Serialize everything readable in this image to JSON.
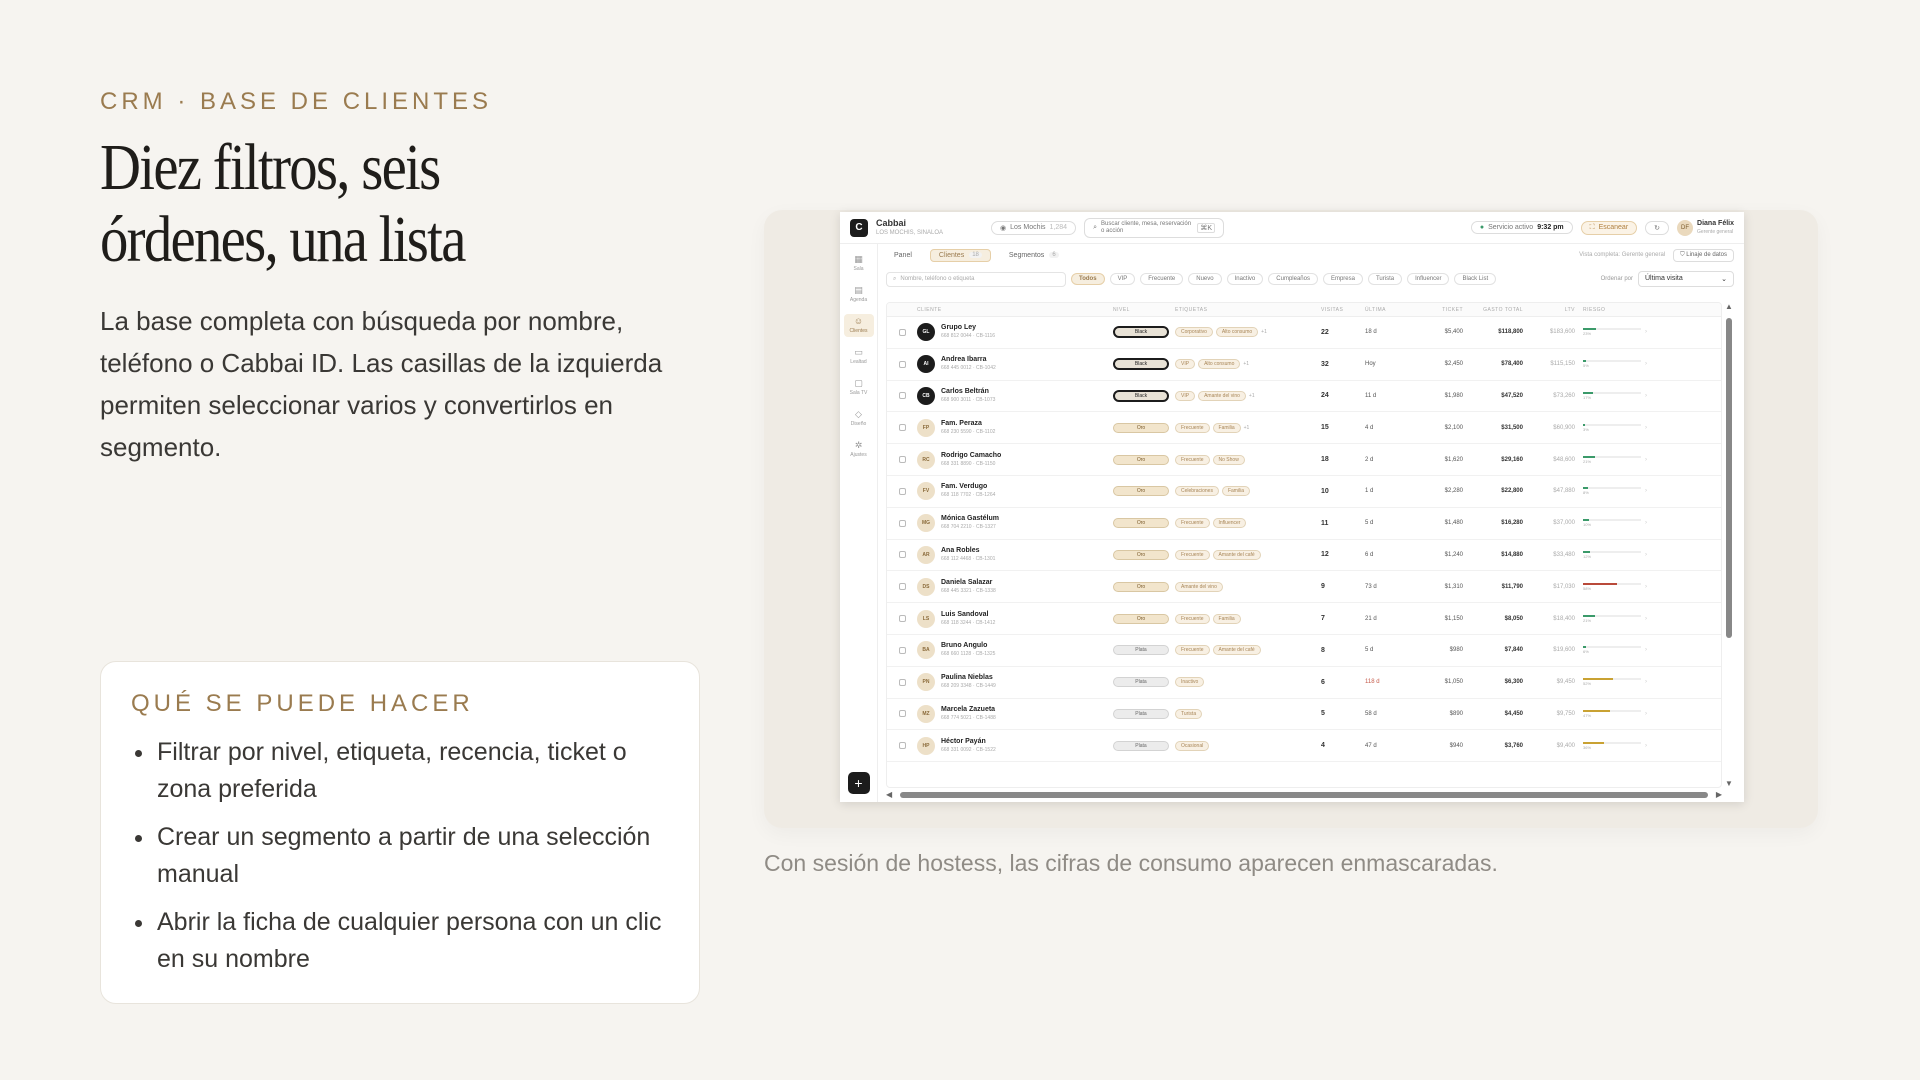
{
  "slide": {
    "eyebrow": "CRM · BASE DE CLIENTES",
    "headline_line1": "Diez filtros, seis",
    "headline_line2": "órdenes, una lista",
    "lead": "La base completa con búsqueda por nombre, teléfono o Cabbai ID. Las casillas de la izquierda permiten seleccionar varios y convertirlos en segmento.",
    "card_title": "QUÉ SE PUEDE HACER",
    "bullets": [
      "Filtrar por nivel, etiqueta, recencia, ticket o zona preferida",
      "Crear un segmento a partir de una selección manual",
      "Abrir la ficha de cualquier persona con un clic en su nombre"
    ],
    "caption": "Con sesión de hostess, las cifras de consumo aparecen enmascaradas."
  },
  "app": {
    "brand": "Cabbai",
    "brand_sub": "LOS MOCHIS, SINALOA",
    "location": "Los Mochis",
    "location_count": "1,284",
    "search_placeholder": "Buscar cliente, mesa, reservación o acción",
    "search_kbd": "⌘K",
    "service_label": "Servicio activo",
    "service_time": "9:32 pm",
    "scan_label": "Escanear",
    "user_initials": "DF",
    "user_name": "Diana Félix",
    "user_role": "Gerente general",
    "sidebar": [
      "Sala",
      "Agenda",
      "Clientes",
      "Lealtad",
      "Sala TV",
      "Diseño",
      "Ajustes"
    ],
    "tabs": [
      {
        "label": "Panel",
        "count": ""
      },
      {
        "label": "Clientes",
        "count": "18"
      },
      {
        "label": "Segmentos",
        "count": "6"
      }
    ],
    "view_label": "Vista completa: Gerente general",
    "lineage_label": "Linaje de datos",
    "filter_search_placeholder": "Nombre, teléfono o etiqueta",
    "chips": [
      "Todos",
      "VIP",
      "Frecuente",
      "Nuevo",
      "Inactivo",
      "Cumpleaños",
      "Empresa",
      "Turista",
      "Influencer",
      "Black List"
    ],
    "order_label": "Ordenar por",
    "order_value": "Última visita",
    "columns": {
      "cliente": "CLIENTE",
      "nivel": "NIVEL",
      "etiquetas": "ETIQUETAS",
      "visitas": "VISITAS",
      "ultima": "ÚLTIMA",
      "ticket": "TICKET",
      "gasto": "GASTO TOTAL",
      "ltv": "LTV",
      "riesgo": "RIESGO"
    },
    "rows": [
      {
        "i": "GL",
        "name": "Grupo Ley",
        "sub": "668 812 0044 · CB-1116",
        "nivel": "Black",
        "tags": [
          "Corporativo",
          "Alto consumo"
        ],
        "more": "+1",
        "vis": "22",
        "ult": "18 d",
        "tic": "$5,400",
        "gas": "$118,800",
        "ltv": "$183,600",
        "risk": 23,
        "risk_color": "#3b9a6a"
      },
      {
        "i": "AI",
        "name": "Andrea Ibarra",
        "sub": "668 445 0012 · CB-1042",
        "nivel": "Black",
        "tags": [
          "VIP",
          "Alto consumo"
        ],
        "more": "+1",
        "vis": "32",
        "ult": "Hoy",
        "tic": "$2,450",
        "gas": "$78,400",
        "ltv": "$115,150",
        "risk": 5,
        "risk_color": "#3b9a6a"
      },
      {
        "i": "CB",
        "name": "Carlos Beltrán",
        "sub": "668 900 3011 · CB-1073",
        "nivel": "Black",
        "tags": [
          "VIP",
          "Amante del vino"
        ],
        "more": "+1",
        "vis": "24",
        "ult": "11 d",
        "tic": "$1,980",
        "gas": "$47,520",
        "ltv": "$73,260",
        "risk": 17,
        "risk_color": "#3b9a6a"
      },
      {
        "i": "FP",
        "name": "Fam. Peraza",
        "sub": "668 230 5590 · CB-1102",
        "nivel": "Oro",
        "tags": [
          "Frecuente",
          "Familia"
        ],
        "more": "+1",
        "vis": "15",
        "ult": "4 d",
        "tic": "$2,100",
        "gas": "$31,500",
        "ltv": "$60,900",
        "risk": 3,
        "risk_color": "#3b9a6a"
      },
      {
        "i": "RC",
        "name": "Rodrigo Camacho",
        "sub": "668 331 8890 · CB-1150",
        "nivel": "Oro",
        "tags": [
          "Frecuente",
          "No Show"
        ],
        "more": "",
        "vis": "18",
        "ult": "2 d",
        "tic": "$1,620",
        "gas": "$29,160",
        "ltv": "$48,600",
        "risk": 21,
        "risk_color": "#3b9a6a"
      },
      {
        "i": "FV",
        "name": "Fam. Verdugo",
        "sub": "668 118 7702 · CB-1264",
        "nivel": "Oro",
        "tags": [
          "Celebraciones",
          "Familia"
        ],
        "more": "",
        "vis": "10",
        "ult": "1 d",
        "tic": "$2,280",
        "gas": "$22,800",
        "ltv": "$47,880",
        "risk": 8,
        "risk_color": "#3b9a6a"
      },
      {
        "i": "MG",
        "name": "Mónica Gastélum",
        "sub": "668 704 2210 · CB-1327",
        "nivel": "Oro",
        "tags": [
          "Frecuente",
          "Influencer"
        ],
        "more": "",
        "vis": "11",
        "ult": "5 d",
        "tic": "$1,480",
        "gas": "$16,280",
        "ltv": "$37,000",
        "risk": 10,
        "risk_color": "#3b9a6a"
      },
      {
        "i": "AR",
        "name": "Ana Robles",
        "sub": "668 112 4468 · CB-1301",
        "nivel": "Oro",
        "tags": [
          "Frecuente",
          "Amante del café"
        ],
        "more": "",
        "vis": "12",
        "ult": "6 d",
        "tic": "$1,240",
        "gas": "$14,880",
        "ltv": "$33,480",
        "risk": 12,
        "risk_color": "#3b9a6a"
      },
      {
        "i": "DS",
        "name": "Daniela Salazar",
        "sub": "668 445 3321 · CB-1338",
        "nivel": "Oro",
        "tags": [
          "Amante del vino"
        ],
        "more": "",
        "vis": "9",
        "ult": "73 d",
        "tic": "$1,310",
        "gas": "$11,790",
        "ltv": "$17,030",
        "risk": 58,
        "risk_color": "#b94a3a"
      },
      {
        "i": "LS",
        "name": "Luis Sandoval",
        "sub": "668 118 3244 · CB-1412",
        "nivel": "Oro",
        "tags": [
          "Frecuente",
          "Familia"
        ],
        "more": "",
        "vis": "7",
        "ult": "21 d",
        "tic": "$1,150",
        "gas": "$8,050",
        "ltv": "$18,400",
        "risk": 21,
        "risk_color": "#3b9a6a"
      },
      {
        "i": "BA",
        "name": "Bruno Angulo",
        "sub": "668 660 1128 · CB-1325",
        "nivel": "Plata",
        "tags": [
          "Frecuente",
          "Amante del café"
        ],
        "more": "",
        "vis": "8",
        "ult": "5 d",
        "tic": "$980",
        "gas": "$7,840",
        "ltv": "$19,600",
        "risk": 6,
        "risk_color": "#3b9a6a"
      },
      {
        "i": "PN",
        "name": "Paulina Nieblas",
        "sub": "668 209 3348 · CB-1449",
        "nivel": "Plata",
        "tags": [
          "Inactivo"
        ],
        "more": "",
        "vis": "6",
        "ult": "118 d",
        "tic": "$1,050",
        "gas": "$6,300",
        "ltv": "$9,450",
        "risk": 52,
        "risk_color": "#c9a233"
      },
      {
        "i": "MZ",
        "name": "Marcela Zazueta",
        "sub": "668 774 5021 · CB-1488",
        "nivel": "Plata",
        "tags": [
          "Turista"
        ],
        "more": "",
        "vis": "5",
        "ult": "58 d",
        "tic": "$890",
        "gas": "$4,450",
        "ltv": "$9,750",
        "risk": 47,
        "risk_color": "#c9a233"
      },
      {
        "i": "HP",
        "name": "Héctor Payán",
        "sub": "668 331 0092 · CB-1522",
        "nivel": "Plata",
        "tags": [
          "Ocasional"
        ],
        "more": "",
        "vis": "4",
        "ult": "47 d",
        "tic": "$940",
        "gas": "$3,760",
        "ltv": "$9,400",
        "risk": 36,
        "risk_color": "#c9a233"
      }
    ]
  }
}
